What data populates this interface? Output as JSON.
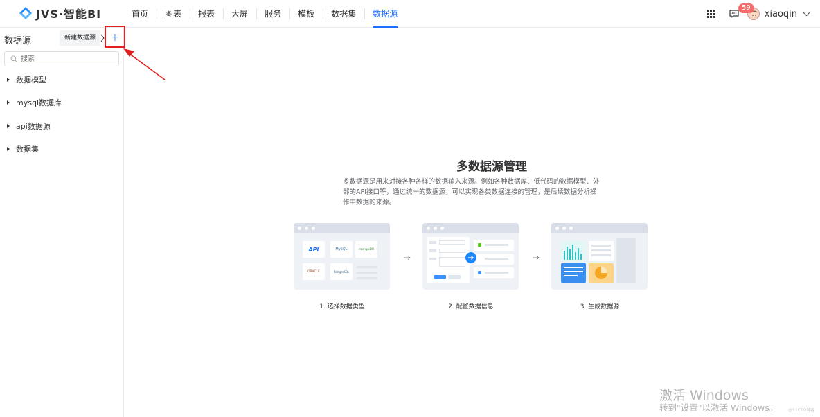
{
  "app": {
    "logo_text": "JVS·智能BI"
  },
  "nav": {
    "items": [
      {
        "label": "首页"
      },
      {
        "label": "图表"
      },
      {
        "label": "报表"
      },
      {
        "label": "大屏"
      },
      {
        "label": "服务"
      },
      {
        "label": "模板"
      },
      {
        "label": "数据集"
      },
      {
        "label": "数据源"
      }
    ],
    "active": "数据源"
  },
  "topright": {
    "notification_count": "59",
    "username": "xiaoqin"
  },
  "sidebar": {
    "title": "数据源",
    "tooltip": "新建数据源",
    "add_label": "+",
    "search_placeholder": "搜索",
    "tree": [
      {
        "label": "数据模型"
      },
      {
        "label": "mysql数据库"
      },
      {
        "label": "api数据源"
      },
      {
        "label": "数据集"
      }
    ]
  },
  "main": {
    "title": "多数据源管理",
    "description": "多数据源是用来对接各种各样的数据输入来源。例如各种数据库、低代码的数据模型、外部的API接口等，通过统一的数据源，可以实现各类数据连接的管理，是后续数据分析操作中数据的来源。",
    "steps": [
      {
        "label": "1. 选择数据类型"
      },
      {
        "label": "2. 配置数据信息"
      },
      {
        "label": "3. 生成数据源"
      }
    ],
    "step1_tiles": {
      "api": "API",
      "mysql": "MySQL",
      "mongodb": "mongoDB",
      "oracle": "ORACLE",
      "postgresql": "PostgreSQL"
    }
  },
  "watermark": {
    "line1": "激活 Windows",
    "line2": "转到\"设置\"以激活 Windows。",
    "credit": "@51CTO博客"
  },
  "colors": {
    "accent": "#1e6fff",
    "highlight_box": "#e02020",
    "badge": "#f56c6c"
  }
}
